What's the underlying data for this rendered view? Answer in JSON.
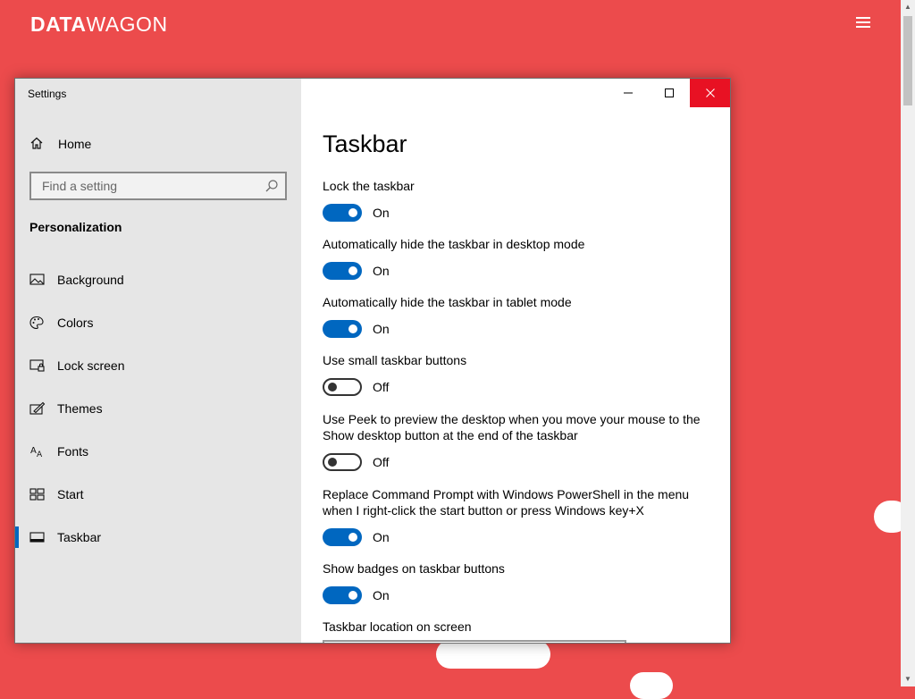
{
  "site": {
    "logo_bold": "DATA",
    "logo_thin": "WAGON",
    "menu_icon": "hamburger-icon",
    "background_color": "#ec4b4c"
  },
  "window": {
    "title": "Settings",
    "controls": [
      "minimize-icon",
      "maximize-icon",
      "close-icon"
    ],
    "close_color": "#e81123"
  },
  "sidebar": {
    "home": {
      "label": "Home",
      "icon": "home-icon"
    },
    "search": {
      "placeholder": "Find a setting",
      "icon": "search-icon"
    },
    "section": "Personalization",
    "items": [
      {
        "label": "Background",
        "icon": "image-icon",
        "selected": false
      },
      {
        "label": "Colors",
        "icon": "palette-icon",
        "selected": false
      },
      {
        "label": "Lock screen",
        "icon": "lock-screen-icon",
        "selected": false
      },
      {
        "label": "Themes",
        "icon": "brush-icon",
        "selected": false
      },
      {
        "label": "Fonts",
        "icon": "font-icon",
        "selected": false
      },
      {
        "label": "Start",
        "icon": "start-icon",
        "selected": false
      },
      {
        "label": "Taskbar",
        "icon": "taskbar-icon",
        "selected": true
      }
    ]
  },
  "content": {
    "title": "Taskbar",
    "accent_color": "#0067c0",
    "settings": [
      {
        "label": "Lock the taskbar",
        "state": "On"
      },
      {
        "label": "Automatically hide the taskbar in desktop mode",
        "state": "On"
      },
      {
        "label": "Automatically hide the taskbar in tablet mode",
        "state": "On"
      },
      {
        "label": "Use small taskbar buttons",
        "state": "Off"
      },
      {
        "label": "Use Peek to preview the desktop when you move your mouse to the Show desktop button at the end of the taskbar",
        "state": "Off"
      },
      {
        "label": "Replace Command Prompt with Windows PowerShell in the menu when I right-click the start button or press Windows key+X",
        "state": "On"
      },
      {
        "label": "Show badges on taskbar buttons",
        "state": "On"
      }
    ],
    "location_label": "Taskbar location on screen"
  }
}
